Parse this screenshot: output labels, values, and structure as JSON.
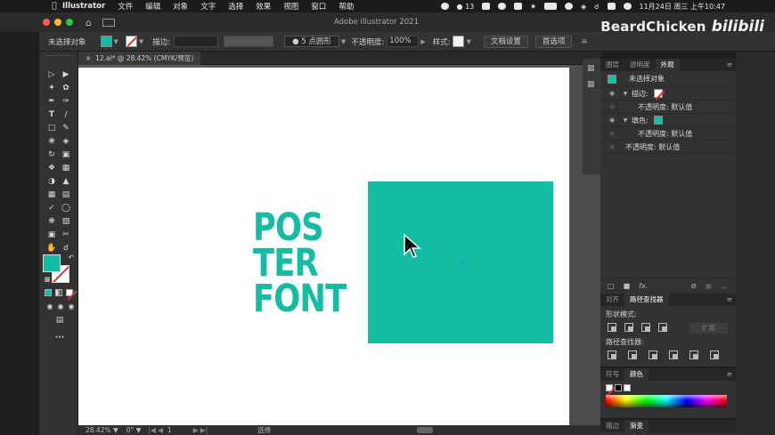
{
  "menubar": {
    "app": "Illustrator",
    "items": [
      "文件",
      "编辑",
      "对象",
      "文字",
      "选择",
      "效果",
      "视图",
      "窗口",
      "帮助"
    ],
    "notification_count": "13",
    "datetime": "11月24日 周三 上午10:47"
  },
  "window": {
    "title": "Adobe Illustrator 2021"
  },
  "watermark": {
    "text": "BeardChicken",
    "logo": "bilibili"
  },
  "controlbar": {
    "selection_label": "未选择对象",
    "stroke_label": "描边:",
    "brush_preset": "5 点圆形",
    "opacity_label": "不透明度:",
    "opacity_value": "100%",
    "style_label": "样式:",
    "doc_setup": "文档设置",
    "preferences": "首选项"
  },
  "document": {
    "tab_label": "12.ai* @ 28.42% (CMYK/预览)"
  },
  "artwork": {
    "lines": [
      "POS",
      "TER",
      "FONT"
    ],
    "accent_color": "#12bda3"
  },
  "status": {
    "zoom": "28.42%",
    "artboard_nav": "1",
    "tool": "选择"
  },
  "appearance_panel": {
    "tabs": [
      "图层",
      "透明度",
      "外观"
    ],
    "active_tab": "外观",
    "title": "未选择对象",
    "rows": [
      {
        "label": "描边:",
        "indent": false,
        "swatch": "none"
      },
      {
        "label": "不透明度: 默认值",
        "indent": true
      },
      {
        "label": "填色:",
        "indent": false,
        "swatch": "#12bda3"
      },
      {
        "label": "不透明度: 默认值",
        "indent": true
      },
      {
        "label": "不透明度: 默认值",
        "indent": false
      }
    ],
    "fx_label": "fx."
  },
  "pathfinder_panel": {
    "tabs": [
      "对齐",
      "路径查找器"
    ],
    "active_tab": "路径查找器",
    "shape_modes_label": "形状模式:",
    "pathfinders_label": "路径查找器:",
    "expand_label": "扩展"
  },
  "color_panel": {
    "tabs": [
      "符号",
      "颜色"
    ],
    "active_tab": "颜色"
  },
  "swatch_panel": {
    "tabs": [
      "描边",
      "渐变"
    ],
    "active_tab": "渐变"
  }
}
